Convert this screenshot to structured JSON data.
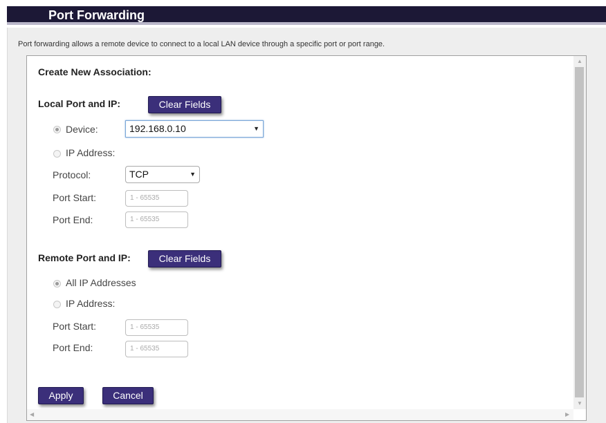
{
  "page": {
    "title": "Port Forwarding",
    "description": "Port forwarding allows a remote device to connect to a local LAN device through a specific port or port range."
  },
  "form": {
    "heading": "Create New Association:",
    "local": {
      "section_label": "Local Port and IP:",
      "clear_label": "Clear Fields",
      "device_label": "Device:",
      "device_value": "192.168.0.10",
      "ip_label": "IP Address:",
      "protocol_label": "Protocol:",
      "protocol_value": "TCP",
      "port_start_label": "Port Start:",
      "port_start_placeholder": "1 - 65535",
      "port_end_label": "Port End:",
      "port_end_placeholder": "1 - 65535",
      "selected_option": "Device"
    },
    "remote": {
      "section_label": "Remote Port and IP:",
      "clear_label": "Clear Fields",
      "all_ip_label": "All IP Addresses",
      "ip_label": "IP Address:",
      "port_start_label": "Port Start:",
      "port_start_placeholder": "1 - 65535",
      "port_end_label": "Port End:",
      "port_end_placeholder": "1 - 65535",
      "selected_option": "All IP Addresses"
    },
    "apply_label": "Apply",
    "cancel_label": "Cancel"
  },
  "icons": {
    "dropdown": "chevron-down-icon",
    "scroll_up": "scroll-up-arrow-icon",
    "scroll_down": "scroll-down-arrow-icon",
    "scroll_left": "scroll-left-arrow-icon",
    "scroll_right": "scroll-right-arrow-icon"
  },
  "colors": {
    "title_bar": "#1c1836",
    "button": "#3b2f7a",
    "panel_bg": "#eeeeee"
  }
}
